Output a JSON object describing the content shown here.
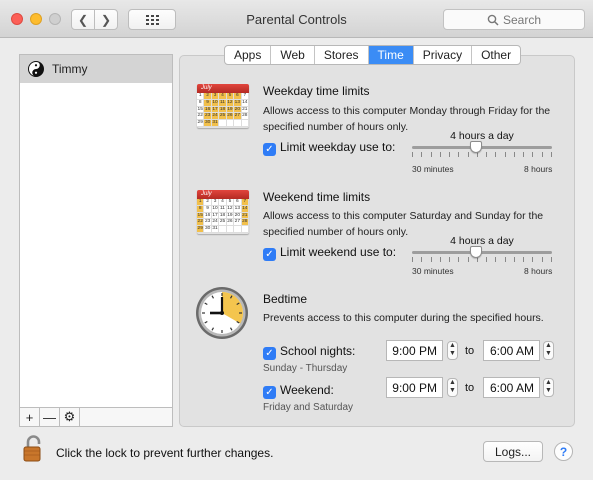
{
  "window": {
    "title": "Parental Controls"
  },
  "toolbar": {
    "search_placeholder": "Search"
  },
  "sidebar": {
    "users": [
      {
        "name": "Timmy"
      }
    ]
  },
  "tabs": [
    {
      "label": "Apps",
      "active": false
    },
    {
      "label": "Web",
      "active": false
    },
    {
      "label": "Stores",
      "active": false
    },
    {
      "label": "Time",
      "active": true
    },
    {
      "label": "Privacy",
      "active": false
    },
    {
      "label": "Other",
      "active": false
    }
  ],
  "weekday": {
    "title": "Weekday time limits",
    "description": "Allows access to this computer Monday through Friday for the specified number of hours only.",
    "checkbox_label": "Limit weekday use to:",
    "checked": true,
    "value_label": "4 hours a day",
    "slider_fraction": 0.46,
    "min_label": "30 minutes",
    "max_label": "8 hours"
  },
  "weekend": {
    "title": "Weekend time limits",
    "description": "Allows access to this computer Saturday and Sunday for the specified number of hours only.",
    "checkbox_label": "Limit weekend use to:",
    "checked": true,
    "value_label": "4 hours a day",
    "slider_fraction": 0.46,
    "min_label": "30 minutes",
    "max_label": "8 hours"
  },
  "bedtime": {
    "title": "Bedtime",
    "description": "Prevents access to this computer during the specified hours.",
    "school": {
      "label": "School nights:",
      "sub": "Sunday - Thursday",
      "from": "9:00 PM",
      "to": "6:00 AM",
      "checked": true
    },
    "weekend": {
      "label": "Weekend:",
      "sub": "Friday and Saturday",
      "from": "9:00 PM",
      "to": "6:00 AM",
      "checked": true
    },
    "to_label": "to"
  },
  "calendar": {
    "month": "July"
  },
  "footer": {
    "lock_text": "Click the lock to prevent further changes.",
    "logs_label": "Logs...",
    "help_label": "?"
  },
  "colors": {
    "accent": "#2f7cf6",
    "calendar_red": "#c8332b",
    "calendar_highlight": "#f2c04b"
  }
}
